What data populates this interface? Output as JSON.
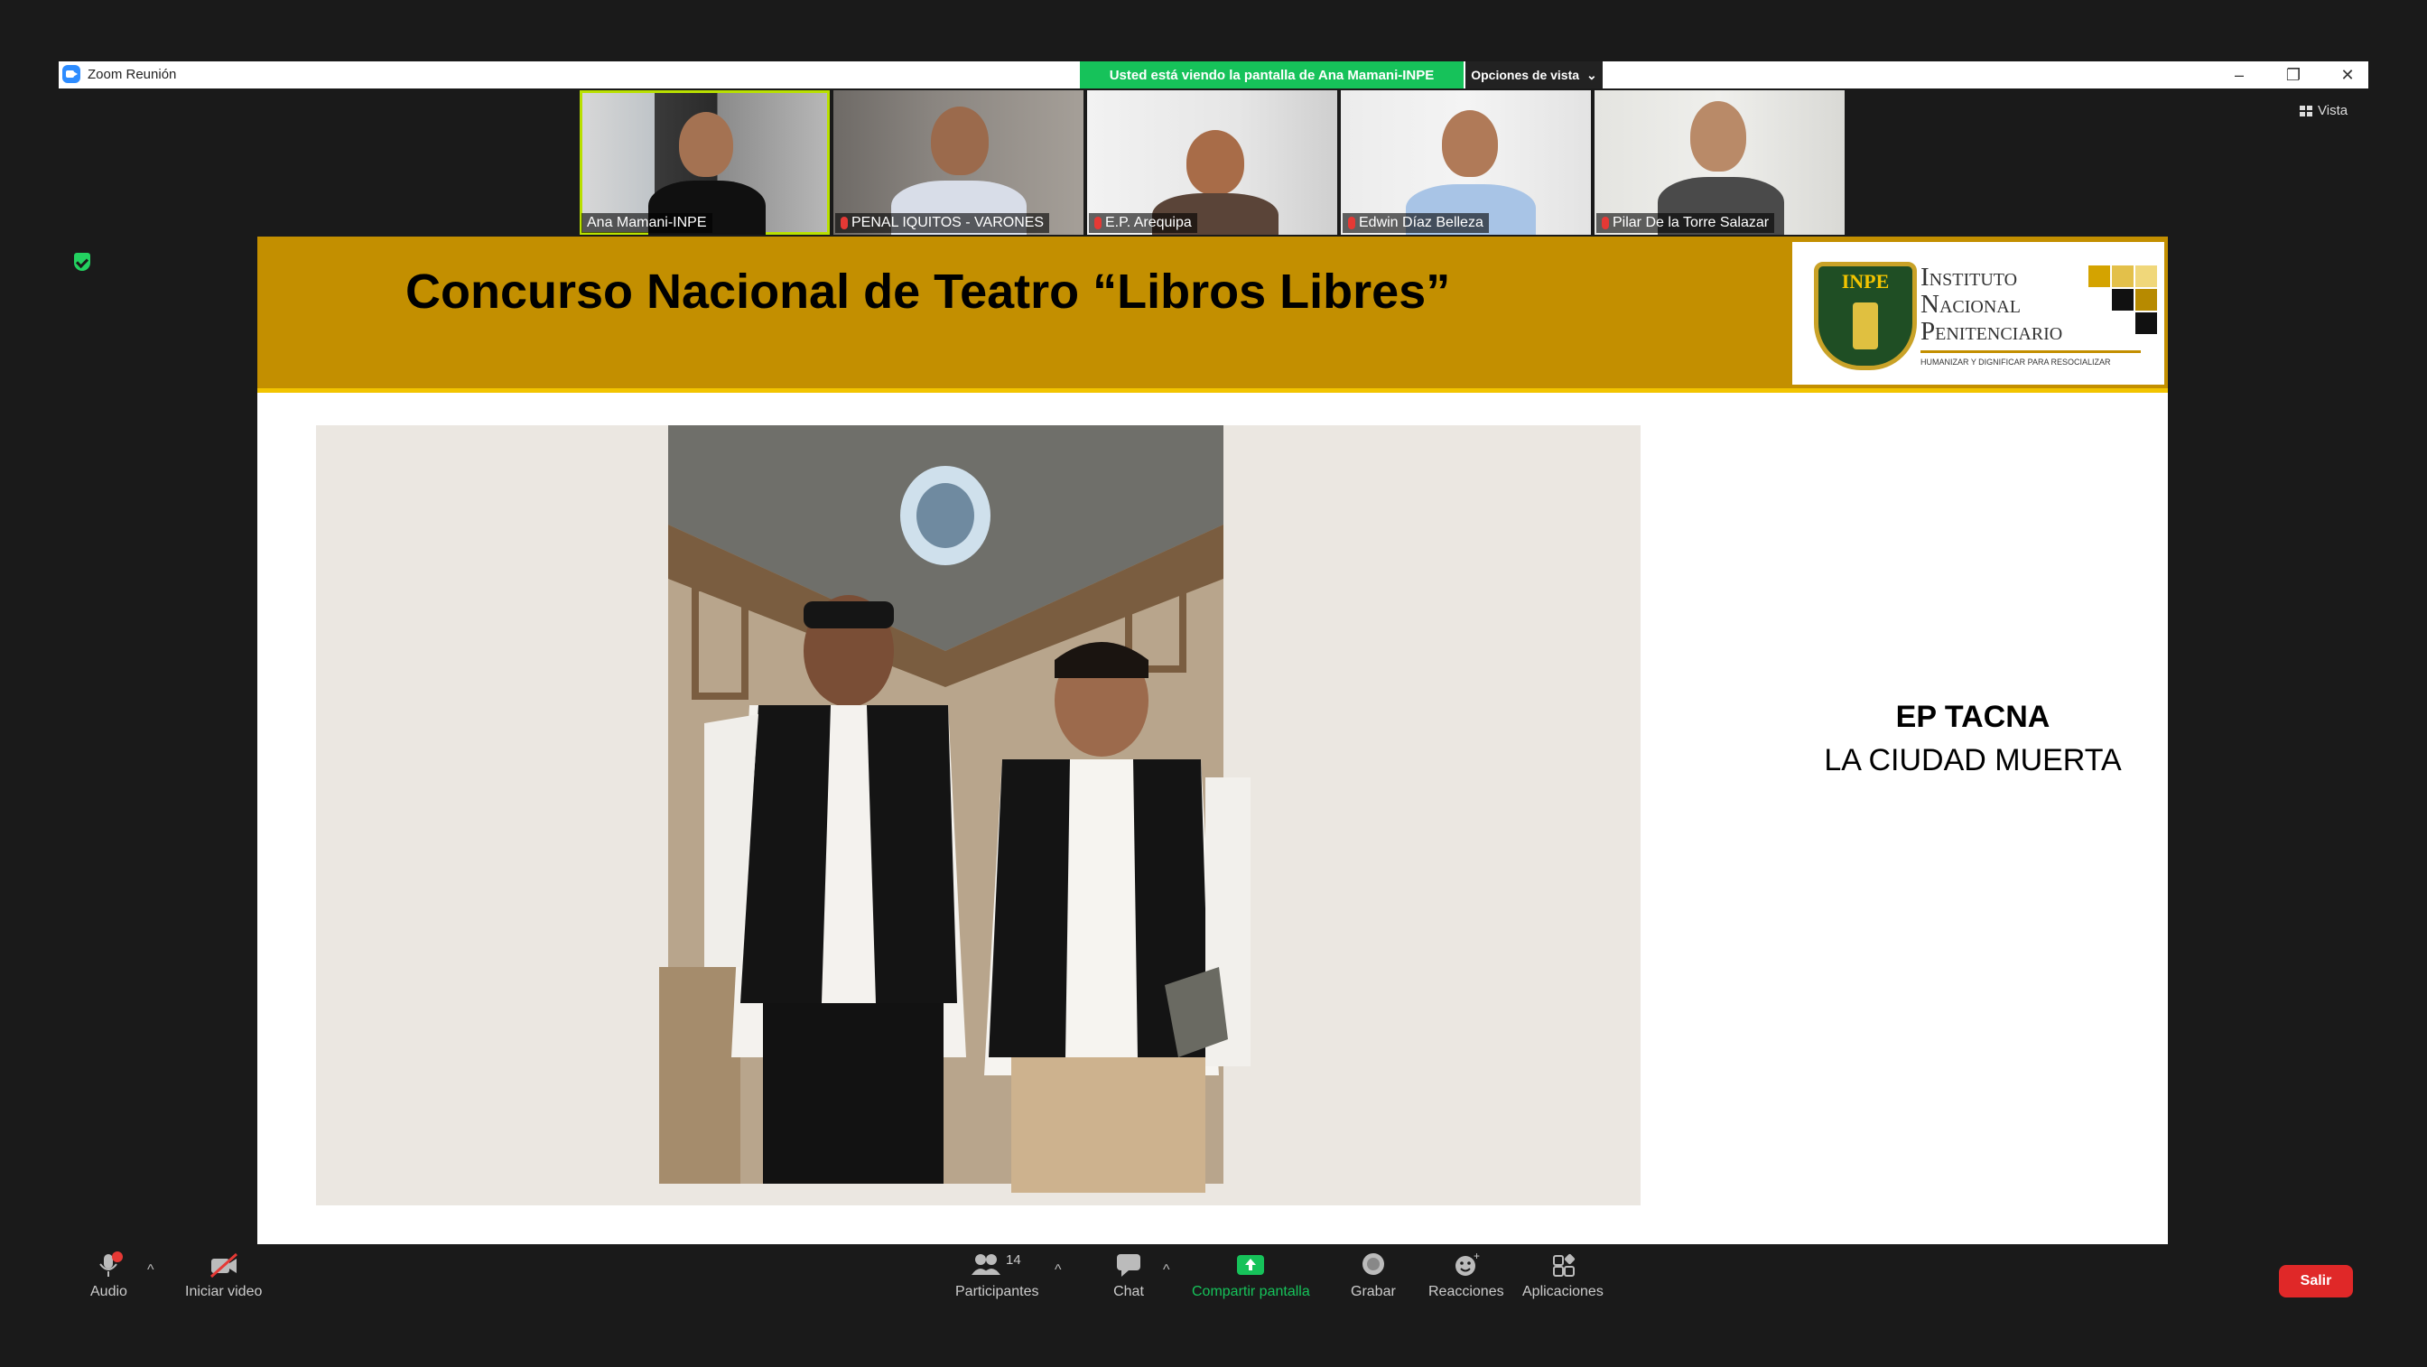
{
  "window": {
    "title": "Zoom Reunión",
    "share_banner": "Usted está viendo la pantalla de Ana Mamani-INPE",
    "view_options": "Opciones de vista",
    "view_options_chevron": "⌄",
    "minimize": "–",
    "restore": "❐",
    "close": "✕"
  },
  "vista_label": "Vista",
  "participants": [
    {
      "name": "Ana Mamani-INPE",
      "muted": false
    },
    {
      "name": "PENAL IQUITOS - VARONES",
      "muted": true
    },
    {
      "name": "E.P. Arequipa",
      "muted": true
    },
    {
      "name": "Edwin Díaz Belleza",
      "muted": true
    },
    {
      "name": "Pilar De la Torre Salazar",
      "muted": true
    }
  ],
  "slide": {
    "title": "Concurso Nacional de Teatro “Libros Libres”",
    "logo": {
      "shield_text": "INPE",
      "line1": "Instituto",
      "line2": "Nacional",
      "line3": "Penitenciario",
      "tagline": "HUMANIZAR Y DIGNIFICAR PARA RESOCIALIZAR"
    },
    "caption_line1": "EP TACNA",
    "caption_line2": "LA CIUDAD MUERTA"
  },
  "toolbar": {
    "audio": "Audio",
    "audio_badge": "!",
    "video": "Iniciar video",
    "participants": "Participantes",
    "participants_count": "14",
    "chat": "Chat",
    "share": "Compartir pantalla",
    "record": "Grabar",
    "reactions": "Reacciones",
    "apps": "Aplicaciones",
    "caret": "^",
    "leave": "Salir"
  },
  "colors": {
    "share_green": "#16c25a",
    "header_gold": "#c38f00",
    "leave_red": "#e02828"
  }
}
